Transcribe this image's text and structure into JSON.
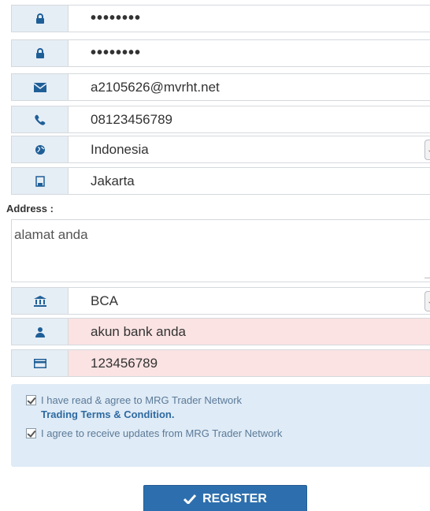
{
  "form": {
    "password": {
      "value": "••••••••",
      "icon": "lock-icon"
    },
    "confirm_password": {
      "value": "••••••••",
      "icon": "lock-icon"
    },
    "email": {
      "value": "a2105626@mvrht.net",
      "icon": "envelope-icon"
    },
    "phone": {
      "value": "08123456789",
      "icon": "phone-icon"
    },
    "country": {
      "value": "Indonesia",
      "icon": "globe-icon"
    },
    "city": {
      "value": "Jakarta",
      "icon": "building-icon"
    },
    "address": {
      "label": "Address :",
      "placeholder": "alamat anda"
    },
    "bank": {
      "value": "BCA",
      "icon": "bank-icon"
    },
    "account_name": {
      "placeholder": "akun bank anda",
      "icon": "user-icon"
    },
    "account_number": {
      "value": "123456789",
      "icon": "card-icon"
    }
  },
  "agreements": {
    "terms_prefix": "I have read & agree to MRG Trader Network",
    "terms_link": "Trading Terms & Condition.",
    "updates": "I agree to receive updates from MRG Trader Network"
  },
  "register_button": {
    "label": "REGISTER"
  },
  "colors": {
    "addon_bg": "#e6eef5",
    "icon": "#1f5f98",
    "error_bg": "#fbe3e3",
    "button": "#2d6fae"
  }
}
